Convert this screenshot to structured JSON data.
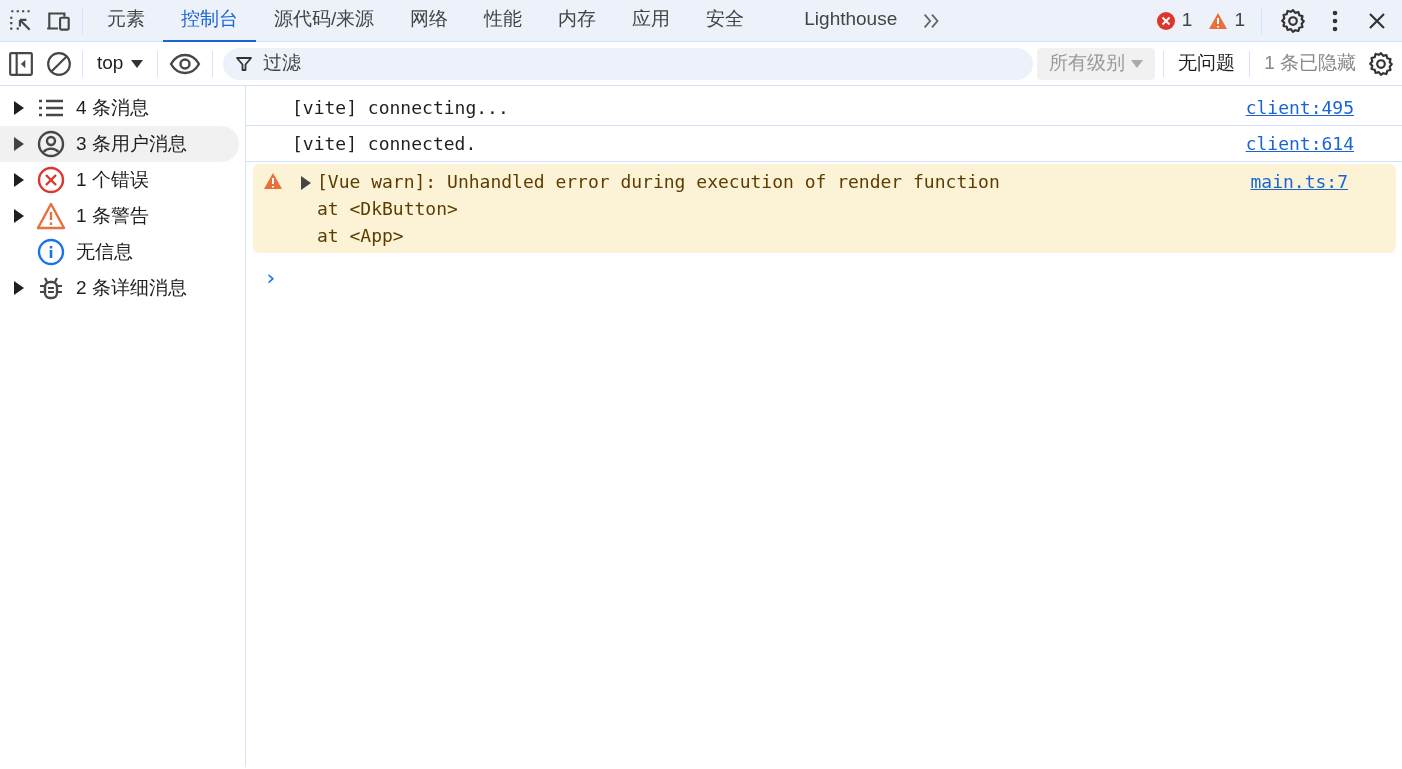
{
  "tabs": [
    {
      "label": "元素",
      "selected": false
    },
    {
      "label": "控制台",
      "selected": true
    },
    {
      "label": "源代码/来源",
      "selected": false
    },
    {
      "label": "网络",
      "selected": false
    },
    {
      "label": "性能",
      "selected": false
    },
    {
      "label": "内存",
      "selected": false
    },
    {
      "label": "应用",
      "selected": false
    },
    {
      "label": "安全",
      "selected": false
    },
    {
      "label": "Lighthouse",
      "selected": false
    }
  ],
  "error_count": "1",
  "warning_count": "1",
  "toolbar": {
    "context": "top",
    "filter": {
      "placeholder": "过滤"
    },
    "levels": "所有级别",
    "issues": "无问题",
    "hidden": "1 条已隐藏"
  },
  "sidebar": {
    "items": [
      {
        "kind": "list",
        "label": "4 条消息",
        "expandable": true,
        "selected": false
      },
      {
        "kind": "user",
        "label": "3 条用户消息",
        "expandable": true,
        "selected": true
      },
      {
        "kind": "error",
        "label": "1 个错误",
        "expandable": true,
        "selected": false
      },
      {
        "kind": "warning",
        "label": "1 条警告",
        "expandable": true,
        "selected": false
      },
      {
        "kind": "info",
        "label": "无信息",
        "expandable": false,
        "selected": false
      },
      {
        "kind": "verbose",
        "label": "2 条详细消息",
        "expandable": true,
        "selected": false
      }
    ]
  },
  "messages": [
    {
      "kind": "log",
      "lines": [
        "[vite] connecting..."
      ],
      "source": "client:495"
    },
    {
      "kind": "log",
      "lines": [
        "[vite] connected."
      ],
      "source": "client:614"
    },
    {
      "kind": "warning",
      "lines": [
        "[Vue warn]: Unhandled error during execution of render function",
        "at <DkButton>",
        "at <App>"
      ],
      "source": "main.ts:7"
    }
  ],
  "prompt": "›"
}
